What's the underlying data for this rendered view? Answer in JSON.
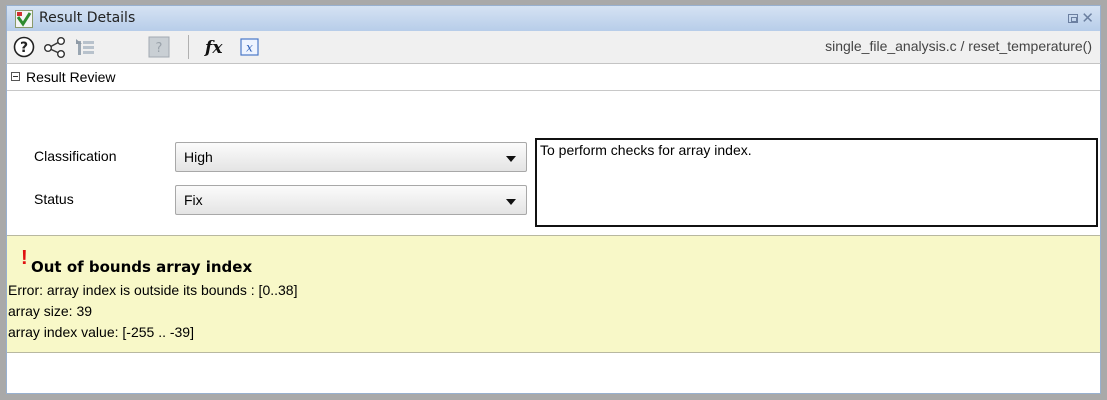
{
  "window": {
    "title": "Result Details"
  },
  "toolbar": {
    "buttons": [
      {
        "icon": "help-icon"
      },
      {
        "icon": "call-graph-icon"
      },
      {
        "icon": "navigate-icon"
      },
      {
        "icon": "unknown-icon"
      },
      {
        "icon": "function-icon",
        "label": "fx"
      },
      {
        "icon": "variable-icon"
      }
    ],
    "breadcrumb": "single_file_analysis.c / reset_temperature()"
  },
  "review": {
    "section_title": "Result Review",
    "classification_label": "Classification",
    "classification_value": "High",
    "status_label": "Status",
    "status_value": "Fix",
    "comment": "To perform checks for array index."
  },
  "message": {
    "severity_icon": "!",
    "title": "Out of bounds array index",
    "lines": [
      "Error: array index is outside its bounds : [0..38]",
      "array size: 39",
      "array index value: [-255 .. -39]"
    ]
  },
  "colors": {
    "title_bar": "#c7d8ee",
    "message_background": "#f8f8c8",
    "error_accent": "#e01010"
  }
}
